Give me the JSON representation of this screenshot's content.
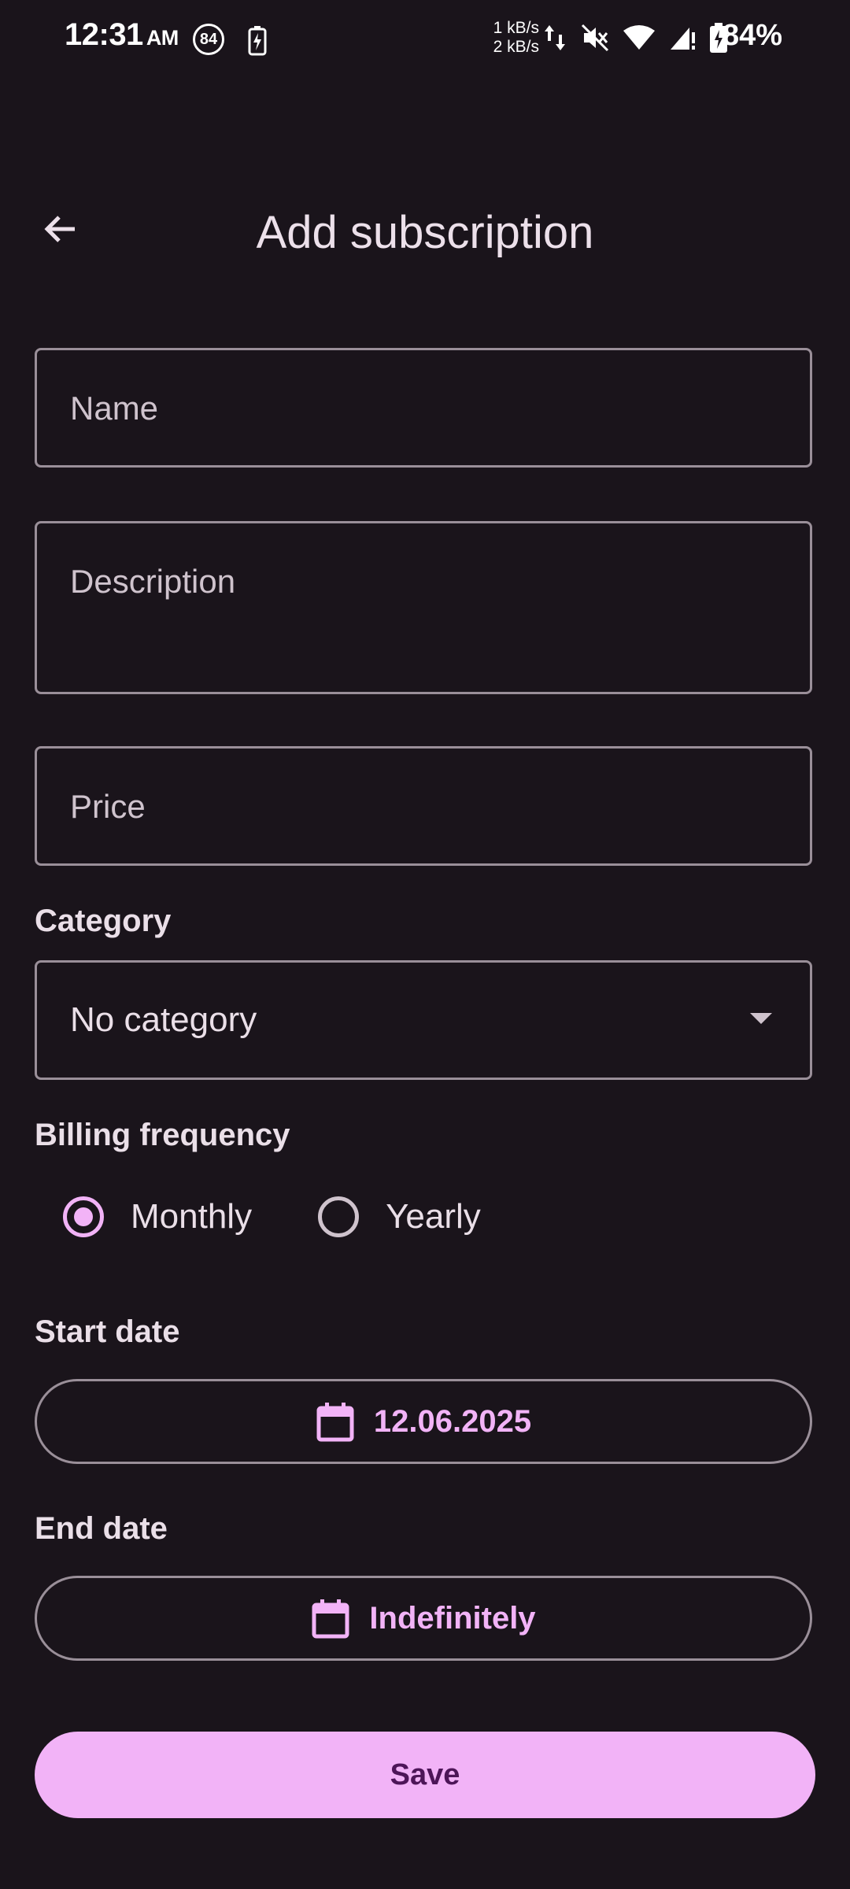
{
  "status_bar": {
    "time": "12:31",
    "ampm": "AM",
    "badge": "84",
    "speed_up": "1 kB/s",
    "speed_down": "2 kB/s",
    "battery_pct": "84%"
  },
  "header": {
    "title": "Add subscription"
  },
  "form": {
    "name_placeholder": "Name",
    "description_placeholder": "Description",
    "price_placeholder": "Price",
    "category_label": "Category",
    "category_value": "No category",
    "billing_label": "Billing frequency",
    "billing_options": [
      "Monthly",
      "Yearly"
    ],
    "billing_selected": "Monthly",
    "start_label": "Start date",
    "start_value": "12.06.2025",
    "end_label": "End date",
    "end_value": "Indefinitely",
    "save_label": "Save"
  },
  "colors": {
    "background": "#1a141b",
    "accent": "#f2b3f7",
    "on_accent": "#4d1558",
    "outline": "#9a8f99"
  }
}
